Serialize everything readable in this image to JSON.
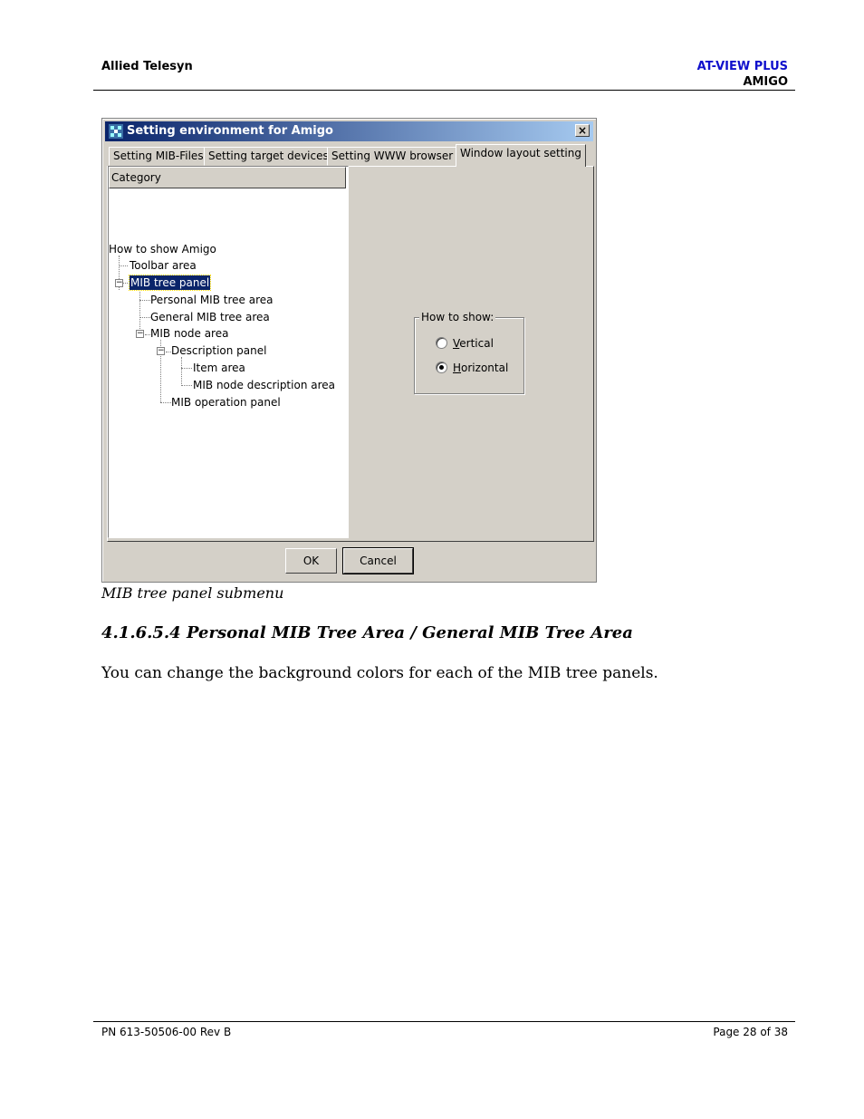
{
  "header": {
    "company": "Allied Telesyn",
    "product": "AT-VIEW PLUS",
    "module": "AMIGO"
  },
  "dialog": {
    "title": "Setting environment for Amigo",
    "close_label": "×",
    "tabs": [
      {
        "label": "Setting MIB-Files"
      },
      {
        "label": "Setting target devices"
      },
      {
        "label": "Setting WWW browser"
      },
      {
        "label": "Window layout setting"
      }
    ],
    "category_header": "Category",
    "tree": {
      "root": "How to show Amigo",
      "toolbar_area": "Toolbar area",
      "mib_tree_panel": "MIB tree panel",
      "personal_mib_tree_area": "Personal MIB tree area",
      "general_mib_tree_area": "General MIB tree area",
      "mib_node_area": "MIB node area",
      "description_panel": "Description panel",
      "item_area": "Item area",
      "mib_node_description_area": "MIB node description area",
      "mib_operation_panel": "MIB operation panel"
    },
    "how_to_show": {
      "legend": "How to show:",
      "vertical_first": "V",
      "vertical_rest": "ertical",
      "horizontal_first": "H",
      "horizontal_rest": "orizontal",
      "selected": "Horizontal"
    },
    "ok_label": "OK",
    "cancel_label": "Cancel"
  },
  "body": {
    "caption": "MIB tree panel submenu",
    "section_heading": "4.1.6.5.4 Personal MIB Tree Area / General MIB Tree Area",
    "paragraph": "You can change the background colors for each of the MIB tree panels."
  },
  "footer": {
    "part_number": "PN 613-50506-00 Rev B",
    "page": "Page 28 of 38"
  }
}
